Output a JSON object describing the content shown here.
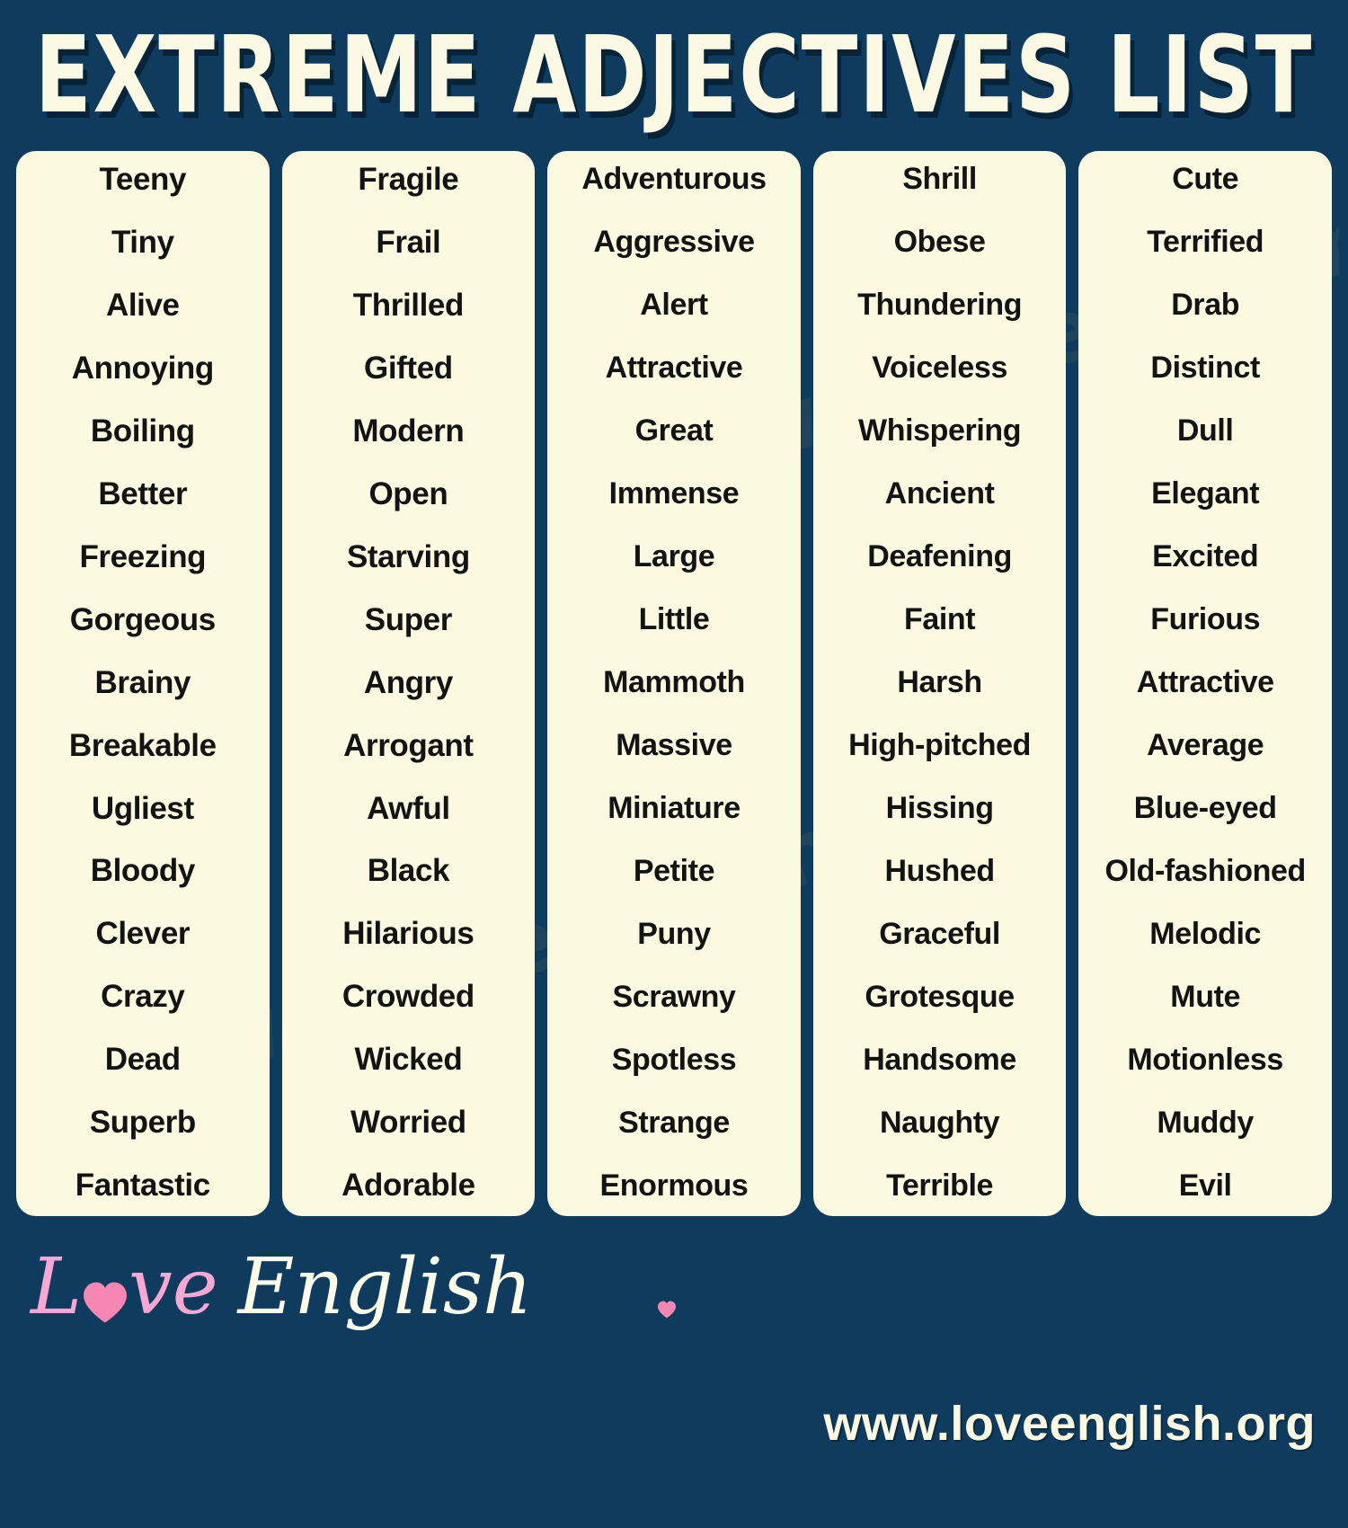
{
  "header": {
    "title": "EXTREME ADJECTIVES LIST"
  },
  "watermark": {
    "text_left": "www.loveenglish.org",
    "text_right": "www.loveenglish.org"
  },
  "colors": {
    "background": "#0f3c5e",
    "card": "#fbfae1",
    "title": "#fbf8e3",
    "word": "#131313",
    "logo_pink": "#f9a8d4",
    "logo_cream": "#fdfbea"
  },
  "columns": [
    {
      "id": "column-1",
      "words": [
        "Teeny",
        "Tiny",
        "Alive",
        "Annoying",
        "Boiling",
        "Better",
        "Freezing",
        "Gorgeous",
        "Brainy",
        "Breakable",
        "Ugliest",
        "Bloody",
        "Clever",
        "Crazy",
        "Dead",
        "Superb",
        "Fantastic"
      ]
    },
    {
      "id": "column-2",
      "words": [
        "Fragile",
        "Frail",
        "Thrilled",
        "Gifted",
        "Modern",
        "Open",
        "Starving",
        "Super",
        "Angry",
        "Arrogant",
        "Awful",
        "Black",
        "Hilarious",
        "Crowded",
        "Wicked",
        "Worried",
        "Adorable"
      ]
    },
    {
      "id": "column-3",
      "words": [
        "Adventurous",
        "Aggressive",
        "Alert",
        "Attractive",
        "Great",
        "Immense",
        "Large",
        "Little",
        "Mammoth",
        "Massive",
        "Miniature",
        "Petite",
        "Puny",
        "Scrawny",
        "Spotless",
        "Strange",
        "Enormous"
      ]
    },
    {
      "id": "column-4",
      "words": [
        "Shrill",
        "Obese",
        "Thundering",
        "Voiceless",
        "Whispering",
        "Ancient",
        "Deafening",
        "Faint",
        "Harsh",
        "High-pitched",
        "Hissing",
        "Hushed",
        "Graceful",
        "Grotesque",
        "Handsome",
        "Naughty",
        "Terrible"
      ]
    },
    {
      "id": "column-5",
      "words": [
        "Cute",
        "Terrified",
        "Drab",
        "Distinct",
        "Dull",
        "Elegant",
        "Excited",
        "Furious",
        "Attractive",
        "Average",
        "Blue-eyed",
        "Old-fashioned",
        "Melodic",
        "Mute",
        "Motionless",
        "Muddy",
        "Evil"
      ]
    }
  ],
  "footer": {
    "logo_word_1": "L",
    "logo_word_1_tail": "ve",
    "logo_word_2": "English",
    "logo_heart_icon": "heart-icon",
    "site_url": "www.loveenglish.org"
  }
}
